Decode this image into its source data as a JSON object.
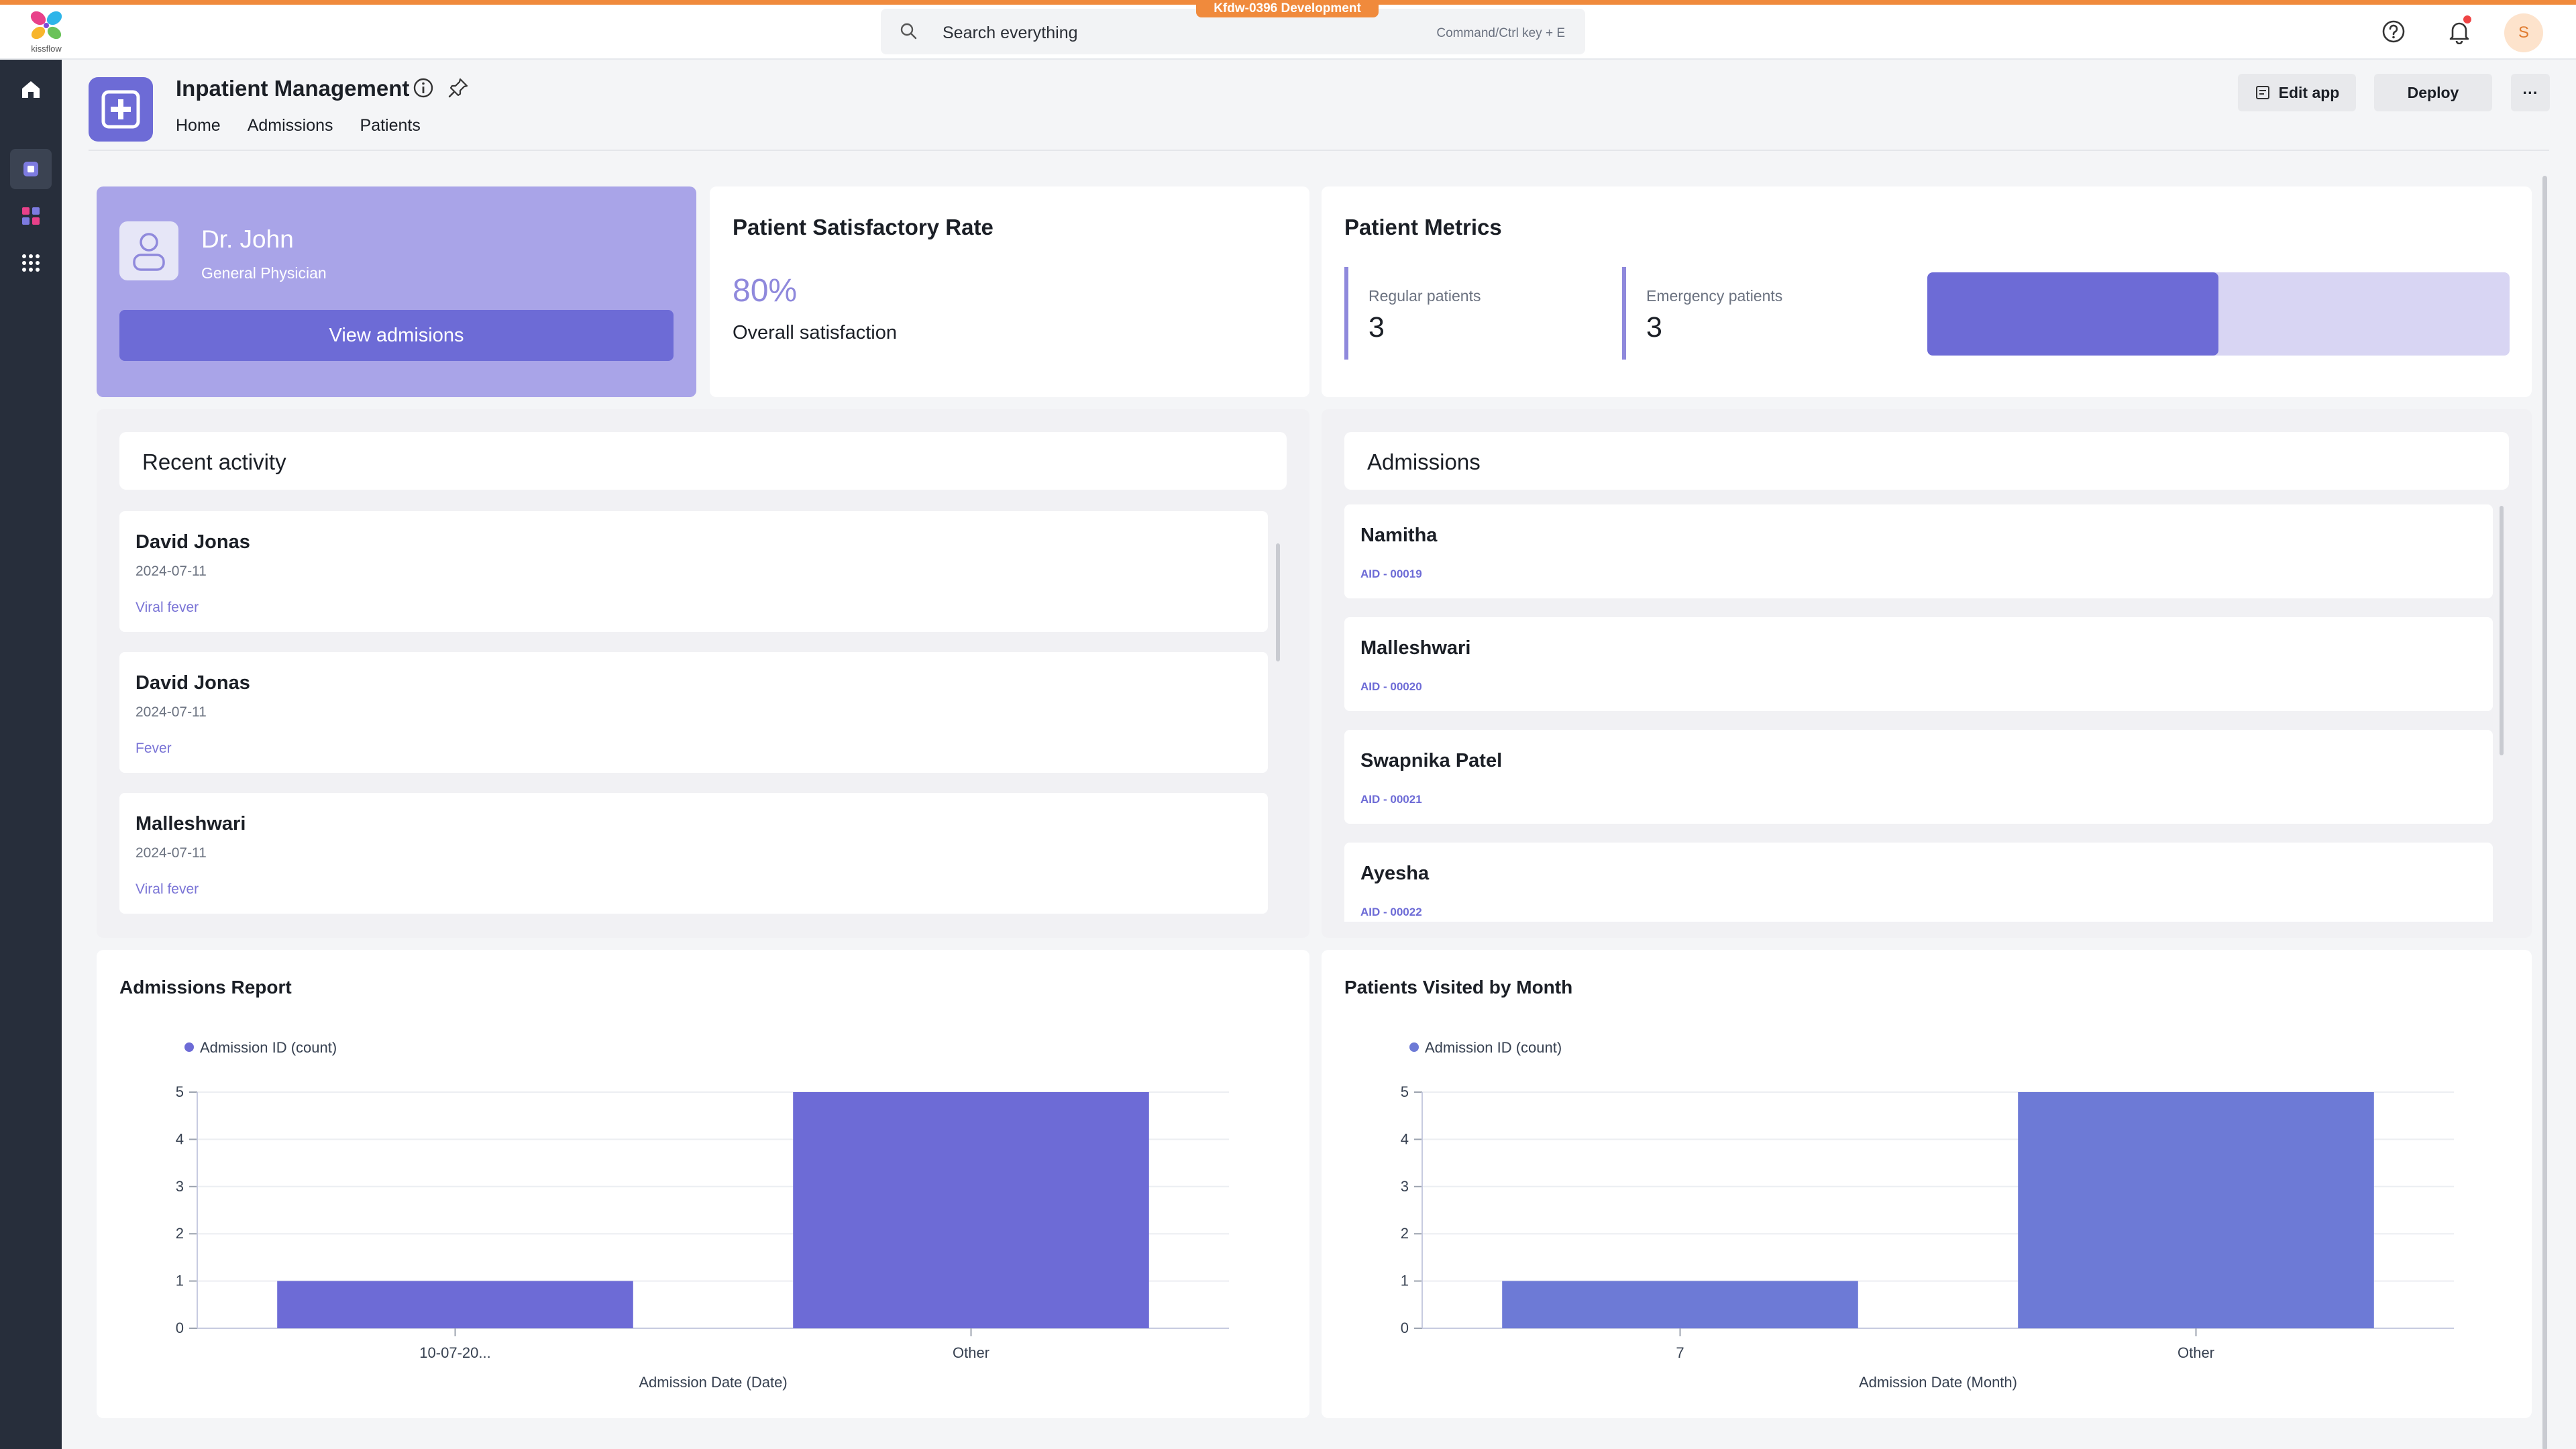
{
  "topbar": {
    "logo_text": "kissflow",
    "env_badge": "Kfdw-0396 Development",
    "search_placeholder": "Search everything",
    "search_shortcut": "Command/Ctrl key + E",
    "avatar_initial": "S",
    "accent": "#f08a3c"
  },
  "app": {
    "title": "Inpatient Management",
    "nav": [
      "Home",
      "Admissions",
      "Patients"
    ],
    "edit_label": "Edit app",
    "deploy_label": "Deploy",
    "more_label": "···",
    "accent": "#6d6bd6"
  },
  "doctor": {
    "name": "Dr. John",
    "role": "General Physician",
    "button": "View admisions"
  },
  "satisfaction": {
    "title": "Patient Satisfactory Rate",
    "value": "80%",
    "subtitle": "Overall satisfaction"
  },
  "metrics": {
    "title": "Patient Metrics",
    "regular_label": "Regular patients",
    "regular_value": "3",
    "emergency_label": "Emergency patients",
    "emergency_value": "3",
    "regular_fraction": 0.5
  },
  "recent_activity": {
    "title": "Recent activity",
    "items": [
      {
        "name": "David Jonas",
        "date": "2024-07-11",
        "tag": "Viral fever"
      },
      {
        "name": "David Jonas",
        "date": "2024-07-11",
        "tag": "Fever"
      },
      {
        "name": "Malleshwari",
        "date": "2024-07-11",
        "tag": "Viral fever"
      }
    ]
  },
  "admissions": {
    "title": "Admissions",
    "items": [
      {
        "name": "Namitha",
        "aid": "AID - 00019"
      },
      {
        "name": "Malleshwari",
        "aid": "AID - 00020"
      },
      {
        "name": "Swapnika Patel",
        "aid": "AID - 00021"
      },
      {
        "name": "Ayesha",
        "aid": "AID - 00022"
      }
    ]
  },
  "chart_data": [
    {
      "type": "bar",
      "title": "Admissions Report",
      "legend": "Admission ID (count)",
      "legend_position": "top-left",
      "categories": [
        "10-07-20...",
        "Other"
      ],
      "values": [
        1,
        5
      ],
      "xlabel": "Admission Date (Date)",
      "ylabel": "",
      "ylim": [
        0,
        5
      ],
      "yticks": [
        0,
        1,
        2,
        3,
        4,
        5
      ],
      "color": "#6d6bd6"
    },
    {
      "type": "bar",
      "title": "Patients Visited by Month",
      "legend": "Admission ID (count)",
      "legend_position": "top-left",
      "categories": [
        "7",
        "Other"
      ],
      "values": [
        1,
        5
      ],
      "xlabel": "Admission Date (Month)",
      "ylabel": "",
      "ylim": [
        0,
        5
      ],
      "yticks": [
        0,
        1,
        2,
        3,
        4,
        5
      ],
      "color": "#6d7ad6"
    }
  ]
}
